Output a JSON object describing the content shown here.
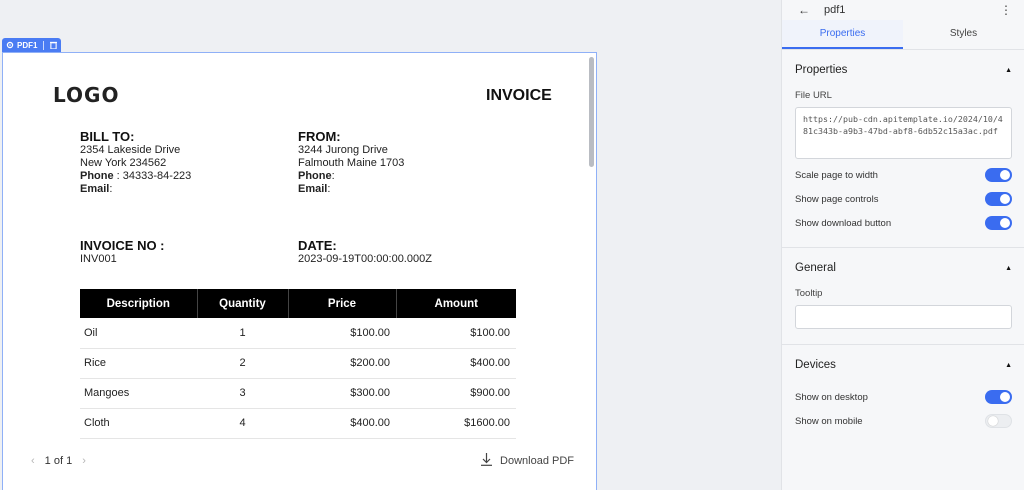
{
  "widget": {
    "tag_label": "PDF1"
  },
  "pdf": {
    "logo_text": "LOGO",
    "invoice_title": "INVOICE",
    "bill_to": {
      "heading": "BILL TO:",
      "line1": "2354 Lakeside Drive",
      "line2": "New York 234562",
      "phone_label": "Phone",
      "phone_value": " : 34333-84-223",
      "email_label": "Email",
      "email_value": ":"
    },
    "from": {
      "heading": "FROM:",
      "line1": "3244 Jurong Drive",
      "line2": "Falmouth Maine 1703",
      "phone_label": "Phone",
      "phone_value": ":",
      "email_label": "Email",
      "email_value": ":"
    },
    "invoice_no": {
      "heading": "INVOICE NO :",
      "value": "INV001"
    },
    "date": {
      "heading": "DATE:",
      "value": "2023-09-19T00:00:00.000Z"
    },
    "table": {
      "headers": [
        "Description",
        "Quantity",
        "Price",
        "Amount"
      ],
      "rows": [
        [
          "Oil",
          "1",
          "$100.00",
          "$100.00"
        ],
        [
          "Rice",
          "2",
          "$200.00",
          "$400.00"
        ],
        [
          "Mangoes",
          "3",
          "$300.00",
          "$900.00"
        ],
        [
          "Cloth",
          "4",
          "$400.00",
          "$1600.00"
        ]
      ]
    },
    "pager": {
      "label": "1 of 1"
    },
    "download_label": "Download PDF"
  },
  "panel": {
    "title": "pdf1",
    "tabs": {
      "properties": "Properties",
      "styles": "Styles"
    },
    "properties_section": {
      "title": "Properties",
      "file_url_label": "File URL",
      "file_url_value": "https://pub-cdn.apitemplate.io/2024/10/481c343b-a9b3-47bd-abf8-6db52c15a3ac.pdf",
      "toggles": [
        {
          "label": "Scale page to width",
          "on": true
        },
        {
          "label": "Show page controls",
          "on": true
        },
        {
          "label": "Show download button",
          "on": true
        }
      ]
    },
    "general_section": {
      "title": "General",
      "tooltip_label": "Tooltip",
      "tooltip_value": ""
    },
    "devices_section": {
      "title": "Devices",
      "toggles": [
        {
          "label": "Show on desktop",
          "on": true
        },
        {
          "label": "Show on mobile",
          "on": false
        }
      ]
    }
  },
  "colors": {
    "accent": "#3a6cf0",
    "widget_tag": "#4a7cf3",
    "table_header": "#000000"
  }
}
